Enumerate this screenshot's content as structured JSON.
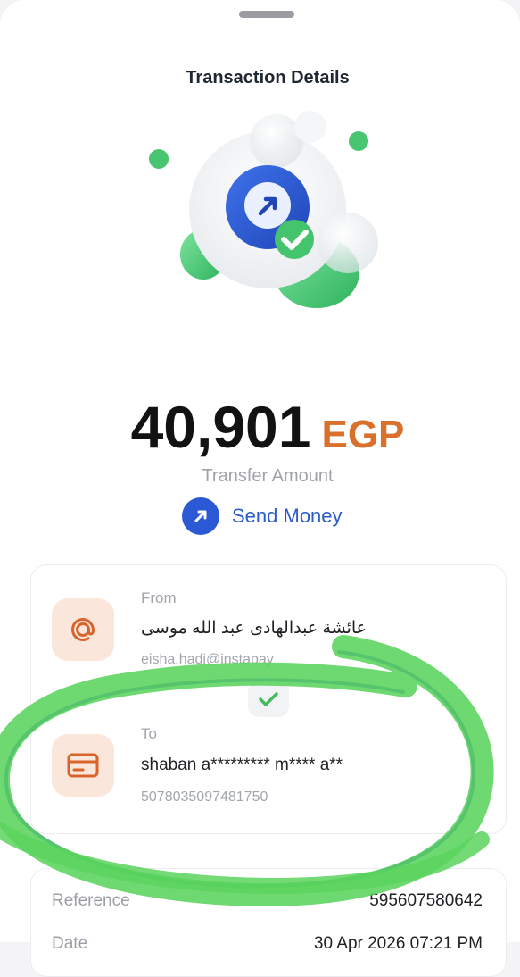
{
  "header": {
    "title": "Transaction Details"
  },
  "amount": {
    "value": "40,901",
    "currency": "EGP",
    "caption": "Transfer Amount"
  },
  "transaction_type": {
    "label": "Send Money",
    "icon": "arrow-up-right-icon"
  },
  "from": {
    "label": "From",
    "name": "عائشة عبدالهادى عبد الله موسى",
    "handle": "eisha.hadi@instapay",
    "icon": "at-sign-icon"
  },
  "to": {
    "label": "To",
    "name": "shaban a********* m**** a**",
    "account": "5078035097481750",
    "icon": "card-icon"
  },
  "details": {
    "reference_label": "Reference",
    "reference_value": "595607580642",
    "date_label": "Date",
    "date_value": "30 Apr 2026 07:21 PM"
  },
  "colors": {
    "accent_blue": "#2b59d6",
    "currency_orange": "#d9702b",
    "success_green": "#3ac56a",
    "icon_tile": "#fbe6db"
  }
}
